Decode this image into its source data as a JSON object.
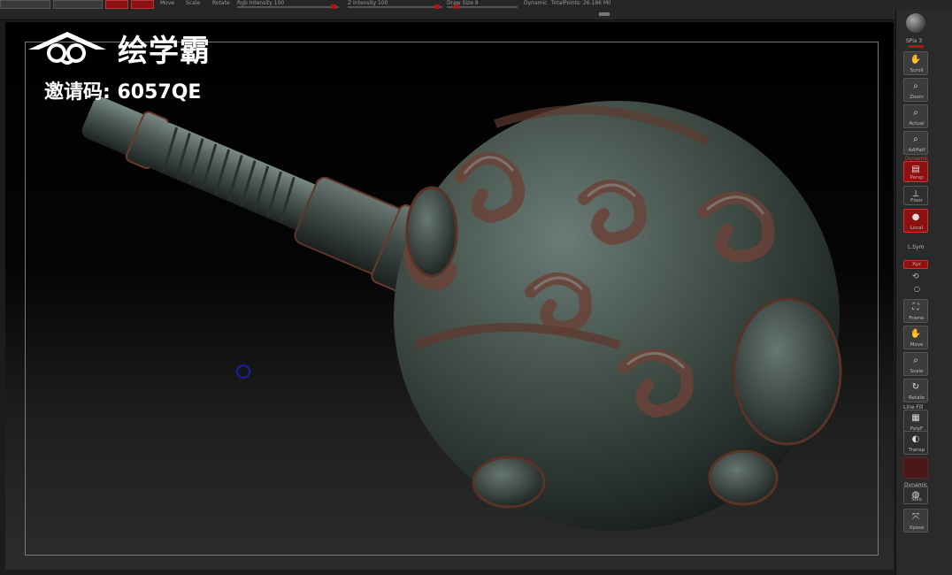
{
  "toolbar": {
    "labels": [
      "Move",
      "Scale",
      "Rotate",
      "Rgb Intensity 100",
      "Z Intensity 100",
      "Draw Size 9",
      "Dynamic",
      "TotalPoints: 26.186 Mil"
    ]
  },
  "watermark": {
    "brand": "绘学霸",
    "invite": "邀请码: 6057QE"
  },
  "shelf": {
    "spix": "SPix 3",
    "scroll": "Scroll",
    "zoom": "Zoom",
    "actual": "Actual",
    "aahalf": "AAHalf",
    "dynamic": "Dynamic",
    "persp": "Persp",
    "floor": "Floor",
    "local": "Local",
    "lsym": "L.Sym",
    "xyz": "Xyz",
    "frame": "Frame",
    "move": "Move",
    "scale": "Scale",
    "rotate": "Rotate",
    "linefill": "Line Fill",
    "polyf": "PolyF",
    "transp": "Transp",
    "dynamic2": "Dynamic",
    "solo": "Solo",
    "xpose": "Xpose"
  },
  "colors": {
    "accent_red": "#b01515",
    "viewport_top": "#000000",
    "viewport_bottom": "#2c2c2c",
    "model_metal": "#4a5652"
  }
}
